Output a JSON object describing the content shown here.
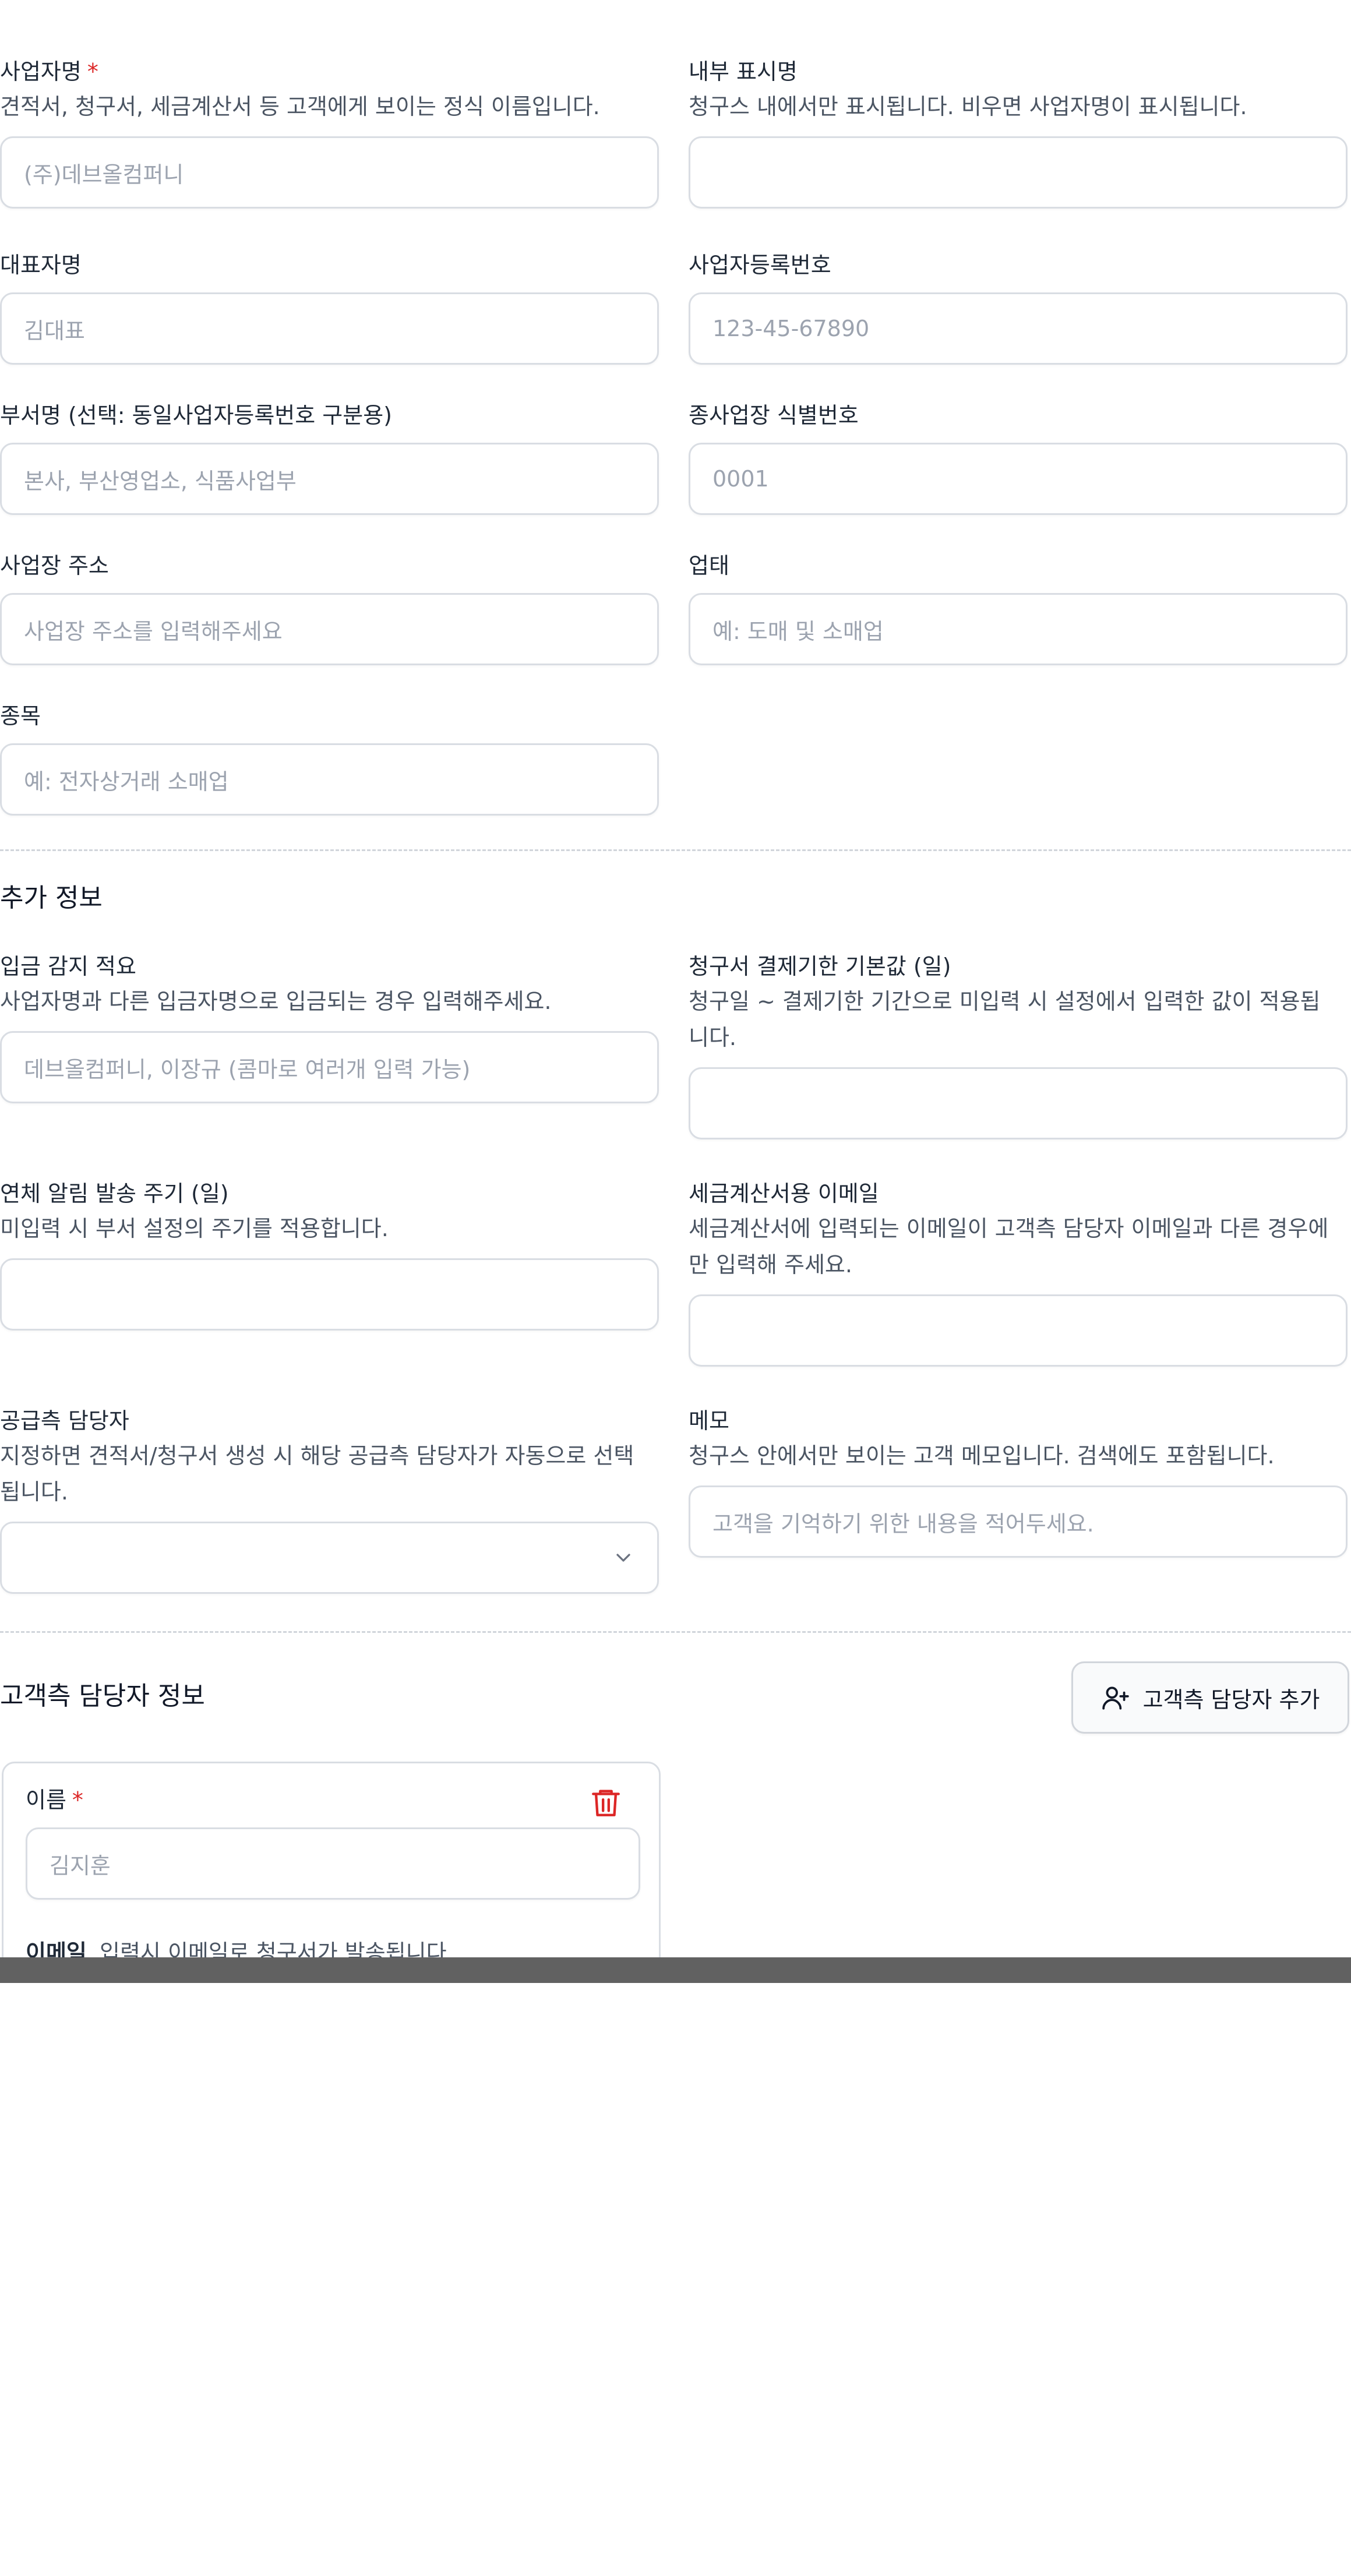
{
  "fields": {
    "biz_name": {
      "label": "사업자명",
      "required_mark": "*",
      "help": "견적서, 청구서, 세금계산서 등 고객에게 보이는 정식 이름입니다.",
      "placeholder": "(주)데브올컴퍼니"
    },
    "display_name": {
      "label": "내부 표시명",
      "help": "청구스 내에서만 표시됩니다. 비우면 사업자명이 표시됩니다.",
      "placeholder": ""
    },
    "ceo_name": {
      "label": "대표자명",
      "placeholder": "김대표"
    },
    "biz_reg_no": {
      "label": "사업자등록번호",
      "placeholder": "123-45-67890"
    },
    "dept_name": {
      "label": "부서명 (선택: 동일사업자등록번호 구분용)",
      "placeholder": "본사, 부산영업소, 식품사업부"
    },
    "branch_id": {
      "label": "종사업장 식별번호",
      "placeholder": "0001"
    },
    "biz_address": {
      "label": "사업장 주소",
      "placeholder": "사업장 주소를 입력해주세요"
    },
    "biz_type": {
      "label": "업태",
      "placeholder": "예: 도매 및 소매업"
    },
    "biz_item": {
      "label": "종목",
      "placeholder": "예: 전자상거래 소매업"
    }
  },
  "extra": {
    "title": "추가 정보",
    "deposit_memo": {
      "label": "입금 감지 적요",
      "help": "사업자명과 다른 입금자명으로 입금되는 경우 입력해주세요.",
      "placeholder": "데브올컴퍼니, 이장규 (콤마로 여러개 입력 가능)"
    },
    "due_default": {
      "label": "청구서 결제기한 기본값 (일)",
      "help_line1": "청구일 ~ 결제기한 기간으로 미입력 시 설정에서 입력한 값이 적용됩",
      "help_line2": "니다.",
      "placeholder": ""
    },
    "overdue_cycle": {
      "label": "연체 알림 발송 주기 (일)",
      "help": "미입력 시 부서 설정의 주기를 적용합니다.",
      "placeholder": ""
    },
    "tax_email": {
      "label": "세금계산서용 이메일",
      "help_line1": "세금계산서에 입력되는 이메일이 고객측 담당자 이메일과 다른 경우에",
      "help_line2": "만 입력해 주세요.",
      "placeholder": ""
    },
    "supplier_manager": {
      "label": "공급측 담당자",
      "help_line1": "지정하면 견적서/청구서 생성 시 해당 공급측 담당자가 자동으로 선택",
      "help_line2": "됩니다.",
      "value": ""
    },
    "memo": {
      "label": "메모",
      "help": "청구스 안에서만 보이는 고객 메모입니다. 검색에도 포함됩니다.",
      "placeholder": "고객을 기억하기 위한 내용을 적어두세요."
    }
  },
  "contacts": {
    "title": "고객측 담당자 정보",
    "add_button": "고객측 담당자 추가",
    "card": {
      "name_label": "이름",
      "required_mark": "*",
      "name_placeholder": "김지훈",
      "email_label": "이메일",
      "email_help": "입력시 이메일로 청구서가 발송됩니다."
    }
  },
  "colors": {
    "required": "#dc2626",
    "delete_icon": "#dc2626",
    "border": "#d9dde3"
  },
  "icons": {
    "add_contact": "user-plus-icon",
    "delete": "trash-icon",
    "dropdown": "chevron-down-icon"
  }
}
